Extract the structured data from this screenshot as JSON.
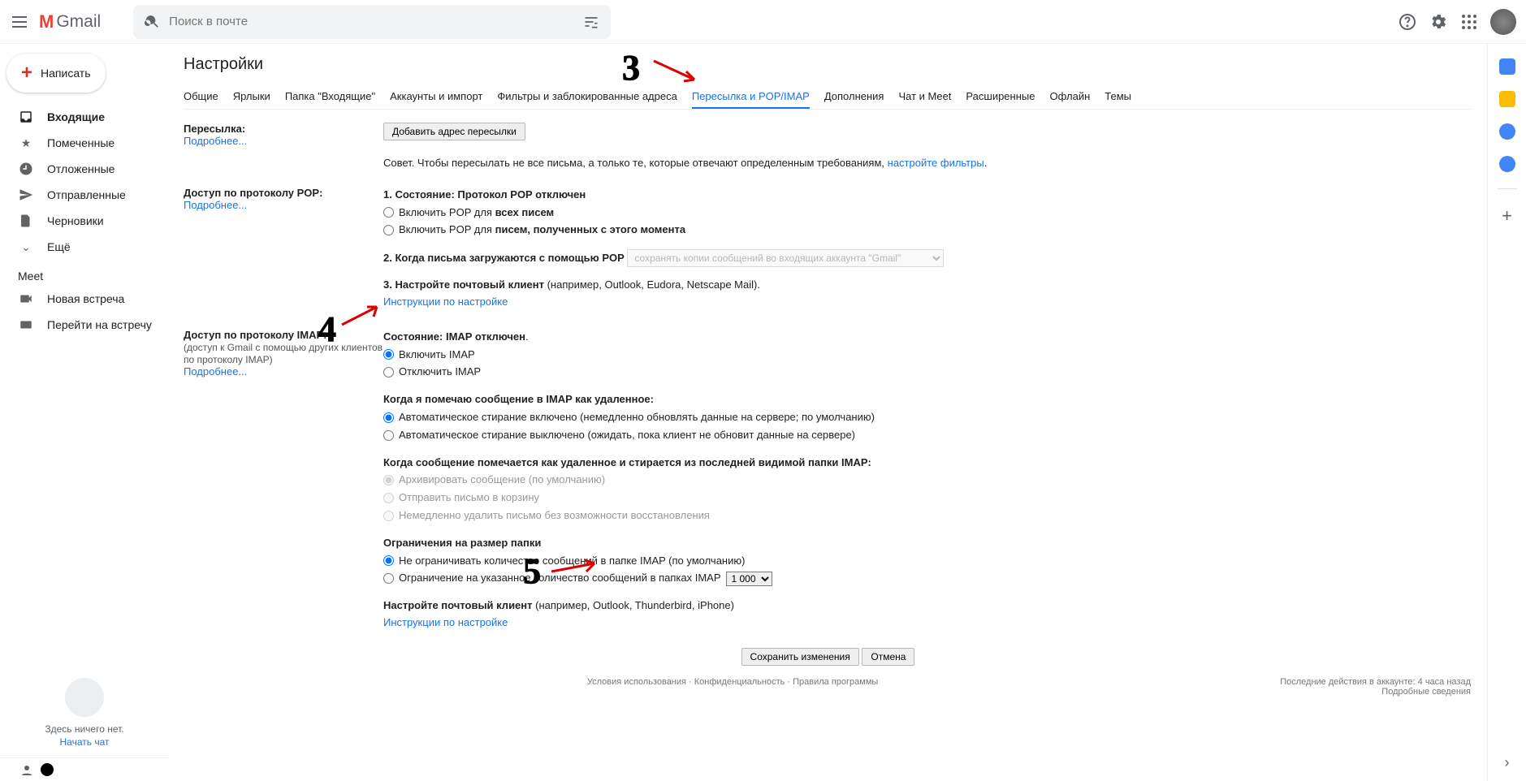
{
  "header": {
    "logo_text": "Gmail",
    "search_placeholder": "Поиск в почте"
  },
  "compose": "Написать",
  "sidebar": {
    "items": [
      {
        "label": "Входящие",
        "icon": "inbox"
      },
      {
        "label": "Помеченные",
        "icon": "star"
      },
      {
        "label": "Отложенные",
        "icon": "clock"
      },
      {
        "label": "Отправленные",
        "icon": "send"
      },
      {
        "label": "Черновики",
        "icon": "file"
      },
      {
        "label": "Ещё",
        "icon": "more"
      }
    ],
    "meet_header": "Meet",
    "meet": [
      {
        "label": "Новая встреча"
      },
      {
        "label": "Перейти на встречу"
      }
    ],
    "empty": "Здесь ничего нет.",
    "start_chat": "Начать чат"
  },
  "page": {
    "title": "Настройки",
    "tabs": [
      "Общие",
      "Ярлыки",
      "Папка \"Входящие\"",
      "Аккаунты и импорт",
      "Фильтры и заблокированные адреса",
      "Пересылка и POP/IMAP",
      "Дополнения",
      "Чат и Meet",
      "Расширенные",
      "Офлайн",
      "Темы"
    ],
    "active_tab_index": 5
  },
  "fwd": {
    "label": "Пересылка:",
    "more": "Подробнее...",
    "add_btn": "Добавить адрес пересылки",
    "tip_pre": "Совет. Чтобы пересылать не все письма, а только те, которые отвечают определенным требованиям, ",
    "tip_link": "настройте фильтры",
    "tip_post": "."
  },
  "pop": {
    "label": "Доступ по протоколу POP:",
    "more": "Подробнее...",
    "s1_b": "1. Состояние: Протокол POP отключен",
    "r1_pre": "Включить POP для ",
    "r1_b": "всех писем",
    "r2_pre": "Включить POP для ",
    "r2_b": "писем, полученных с этого момента",
    "s2_b": "2. Когда письма загружаются с помощью POP",
    "s2_sel": "сохранять копии сообщений во входящих аккаунта \"Gmail\"",
    "s3_b": "3. Настройте почтовый клиент",
    "s3_t": " (например, Outlook, Eudora, Netscape Mail).",
    "s3_link": "Инструкции по настройке"
  },
  "imap": {
    "label": "Доступ по протоколу IMAP:",
    "sub": "(доступ к Gmail с помощью других клиентов по протоколу IMAP)",
    "more": "Подробнее...",
    "st_b": "Состояние: IMAP отключен",
    "r1": "Включить IMAP",
    "r2": "Отключить IMAP",
    "del_h": "Когда я помечаю сообщение в IMAP как удаленное:",
    "del_r1": "Автоматическое стирание включено (немедленно обновлять данные на сервере; по умолчанию)",
    "del_r2": "Автоматическое стирание выключено (ожидать, пока клиент не обновит данные на сервере)",
    "era_h": "Когда сообщение помечается как удаленное и стирается из последней видимой папки IMAP:",
    "era_r1": "Архивировать сообщение (по умолчанию)",
    "era_r2": "Отправить письмо в корзину",
    "era_r3": "Немедленно удалить письмо без возможности восстановления",
    "lim_h": "Ограничения на размер папки",
    "lim_r1": "Не ограничивать количество сообщений в папке IMAP (по умолчанию)",
    "lim_r2": "Ограничение на указанное количество сообщений в папках IMAP",
    "lim_sel": "1 000",
    "cli_b": "Настройте почтовый клиент",
    "cli_t": " (например, Outlook, Thunderbird, iPhone)",
    "cli_link": "Инструкции по настройке"
  },
  "actions": {
    "save": "Сохранить изменения",
    "cancel": "Отмена"
  },
  "footer": {
    "left": "Условия использования · Конфиденциальность · Правила программы",
    "r1": "Последние действия в аккаунте: 4 часа назад",
    "r2": "Подробные сведения"
  },
  "annotations": {
    "n3": "3",
    "n4": "4",
    "n5": "5"
  }
}
